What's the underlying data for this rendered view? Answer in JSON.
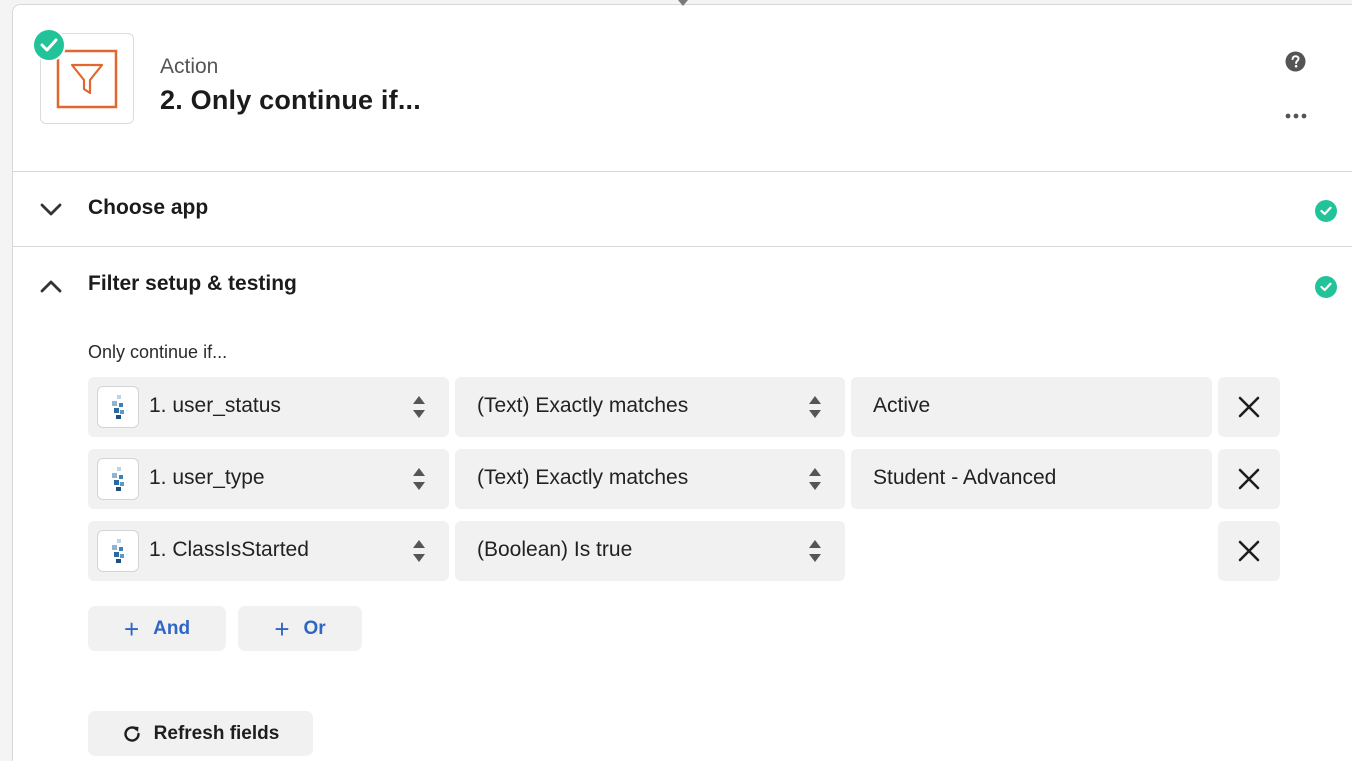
{
  "colors": {
    "accent_green": "#23c39a",
    "filter_orange": "#e0672d",
    "link_blue": "#2f66c4",
    "field_bg": "#f1f1f1"
  },
  "step": {
    "kind": "Action",
    "title": "2. Only continue if...",
    "app_icon": "filter-funnel-icon",
    "status": "complete"
  },
  "header_actions": {
    "help_icon": "question-circle-icon",
    "more_icon": "ellipsis-icon"
  },
  "sections": {
    "choose_app": {
      "label": "Choose app",
      "expanded": false,
      "complete": true
    },
    "filter_setup": {
      "label": "Filter setup & testing",
      "expanded": true,
      "complete": true
    }
  },
  "filter": {
    "intro": "Only continue if...",
    "conditions": [
      {
        "field": "1. user_status",
        "operator": "(Text) Exactly matches",
        "value": "Active"
      },
      {
        "field": "1. user_type",
        "operator": "(Text) Exactly matches",
        "value": "Student - Advanced"
      },
      {
        "field": "1. ClassIsStarted",
        "operator": "(Boolean) Is true",
        "value": ""
      }
    ],
    "and_label": "And",
    "or_label": "Or",
    "refresh_label": "Refresh fields"
  }
}
